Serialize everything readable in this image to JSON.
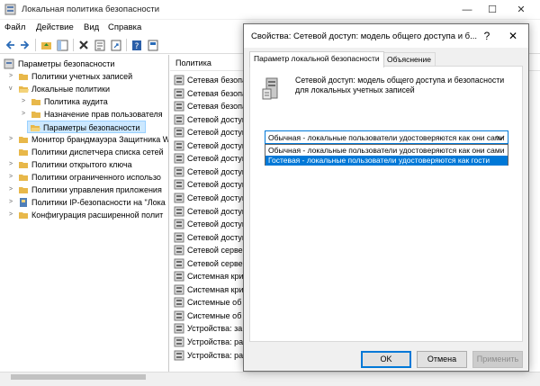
{
  "window": {
    "title": "Локальная политика безопасности",
    "min": "—",
    "max": "☐",
    "close": "✕"
  },
  "menu": [
    "Файл",
    "Действие",
    "Вид",
    "Справка"
  ],
  "tree": [
    {
      "label": "Параметры безопасности",
      "level": 0,
      "expander": ""
    },
    {
      "label": "Политики учетных записей",
      "level": 1,
      "expander": ">"
    },
    {
      "label": "Локальные политики",
      "level": 1,
      "expander": "v"
    },
    {
      "label": "Политика аудита",
      "level": 2,
      "expander": ">"
    },
    {
      "label": "Назначение прав пользователя",
      "level": 2,
      "expander": ">"
    },
    {
      "label": "Параметры безопасности",
      "level": 2,
      "expander": "",
      "selected": true
    },
    {
      "label": "Монитор брандмауэра Защитника Win",
      "level": 1,
      "expander": ">"
    },
    {
      "label": "Политики диспетчера списка сетей",
      "level": 1,
      "expander": ""
    },
    {
      "label": "Политики открытого ключа",
      "level": 1,
      "expander": ">"
    },
    {
      "label": "Политики ограниченного использо",
      "level": 1,
      "expander": ">"
    },
    {
      "label": "Политики управления приложения",
      "level": 1,
      "expander": ">"
    },
    {
      "label": "Политики IP-безопасности на \"Лока",
      "level": 1,
      "expander": ">"
    },
    {
      "label": "Конфигурация расширенной полит",
      "level": 1,
      "expander": ">"
    }
  ],
  "list": {
    "header": "Политика",
    "rows": [
      "Сетевая безопа",
      "Сетевая безопа",
      "Сетевая безопа",
      "Сетевой доступ",
      "Сетевой доступ",
      "Сетевой доступ",
      "Сетевой доступ",
      "Сетевой доступ",
      "Сетевой доступ",
      "Сетевой доступ",
      "Сетевой доступ",
      "Сетевой доступ",
      "Сетевой доступ",
      "Сетевой сервер",
      "Сетевой сервер",
      "Системная кри",
      "Системная кри",
      "Системные об",
      "Системные об",
      "Устройства: за",
      "Устройства: ра",
      "Устройства: ра"
    ]
  },
  "dialog": {
    "title": "Свойства: Сетевой доступ: модель общего доступа и б...",
    "help": "?",
    "close": "✕",
    "tabs": [
      "Параметр локальной безопасности",
      "Объяснение"
    ],
    "description": "Сетевой доступ: модель общего доступа и безопасности для локальных учетных записей",
    "combo_value": "Обычная - локальные пользователи удостоверяются как они сами",
    "options": [
      "Обычная - локальные пользователи удостоверяются как они сами",
      "Гостевая - локальные пользователи удостоверяются как гости"
    ],
    "ok": "OK",
    "cancel": "Отмена",
    "apply": "Применить"
  },
  "colors": {
    "accent": "#0078d7",
    "selection": "#cce8ff",
    "folder": "#e8b84a"
  }
}
